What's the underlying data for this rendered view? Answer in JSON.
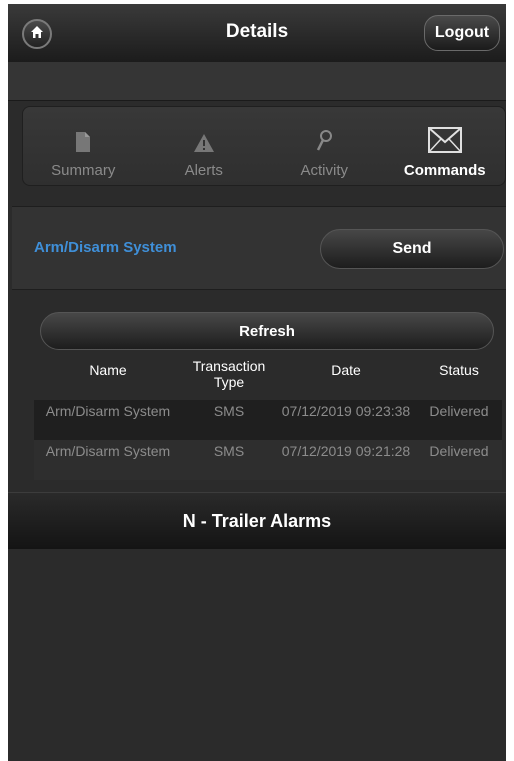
{
  "header": {
    "title": "Details",
    "logout_label": "Logout",
    "home_icon": "home-icon"
  },
  "tabs": [
    {
      "label": "Summary",
      "icon": "document-icon",
      "active": false
    },
    {
      "label": "Alerts",
      "icon": "alert-icon",
      "active": false
    },
    {
      "label": "Activity",
      "icon": "search-icon",
      "active": false
    },
    {
      "label": "Commands",
      "icon": "envelope-icon",
      "active": true
    }
  ],
  "command": {
    "name": "Arm/Disarm System",
    "send_label": "Send"
  },
  "history": {
    "refresh_label": "Refresh",
    "columns": [
      "Name",
      "Transaction Type",
      "Date",
      "Status"
    ],
    "rows": [
      {
        "name": "Arm/Disarm System",
        "type": "SMS",
        "date": "07/12/2019 09:23:38",
        "status": "Delivered"
      },
      {
        "name": "Arm/Disarm System",
        "type": "SMS",
        "date": "07/12/2019 09:21:28",
        "status": "Delivered"
      }
    ]
  },
  "section": {
    "title": "N - Trailer Alarms"
  },
  "colors": {
    "accent_link": "#3f8fd8",
    "background": "#2b2b2b",
    "active_tab_text": "#ffffff",
    "inactive_tab_text": "#8a8a8a"
  }
}
